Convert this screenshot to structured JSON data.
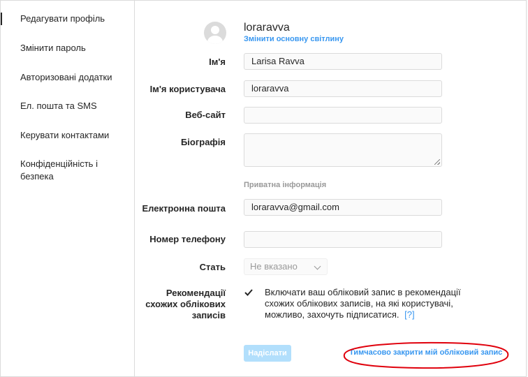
{
  "sidebar": {
    "items": [
      {
        "label": "Редагувати профіль"
      },
      {
        "label": "Змінити пароль"
      },
      {
        "label": "Авторизовані додатки"
      },
      {
        "label": "Ел. пошта та SMS"
      },
      {
        "label": "Керувати контактами"
      },
      {
        "label": "Конфіденційність і безпека"
      }
    ]
  },
  "profile": {
    "username": "loraravva",
    "change_photo": "Змінити основну світлину"
  },
  "form": {
    "name": {
      "label": "Ім'я",
      "value": "Larisa  Ravva"
    },
    "user": {
      "label": "Ім'я користувача",
      "value": "loraravva"
    },
    "website": {
      "label": "Веб-сайт",
      "value": ""
    },
    "bio": {
      "label": "Біографія",
      "value": ""
    },
    "private_header": "Приватна інформація",
    "email": {
      "label": "Електронна пошта",
      "value": "loraravva@gmail.com"
    },
    "phone": {
      "label": "Номер телефону",
      "value": ""
    },
    "gender": {
      "label": "Стать",
      "value": "Не вказано"
    },
    "recommend": {
      "label": "Рекомендації схожих облікових записів",
      "text": "Включати ваш обліковий запис в рекомендації схожих облікових записів, на які користувачі, можливо, захочуть підписатися.",
      "help": "[?]",
      "checked": true
    },
    "submit": "Надіслати",
    "disable_link": "Тимчасово закрити мій обліковий запис"
  },
  "colors": {
    "accent": "#3897f0",
    "annotation": "#e0000c"
  }
}
